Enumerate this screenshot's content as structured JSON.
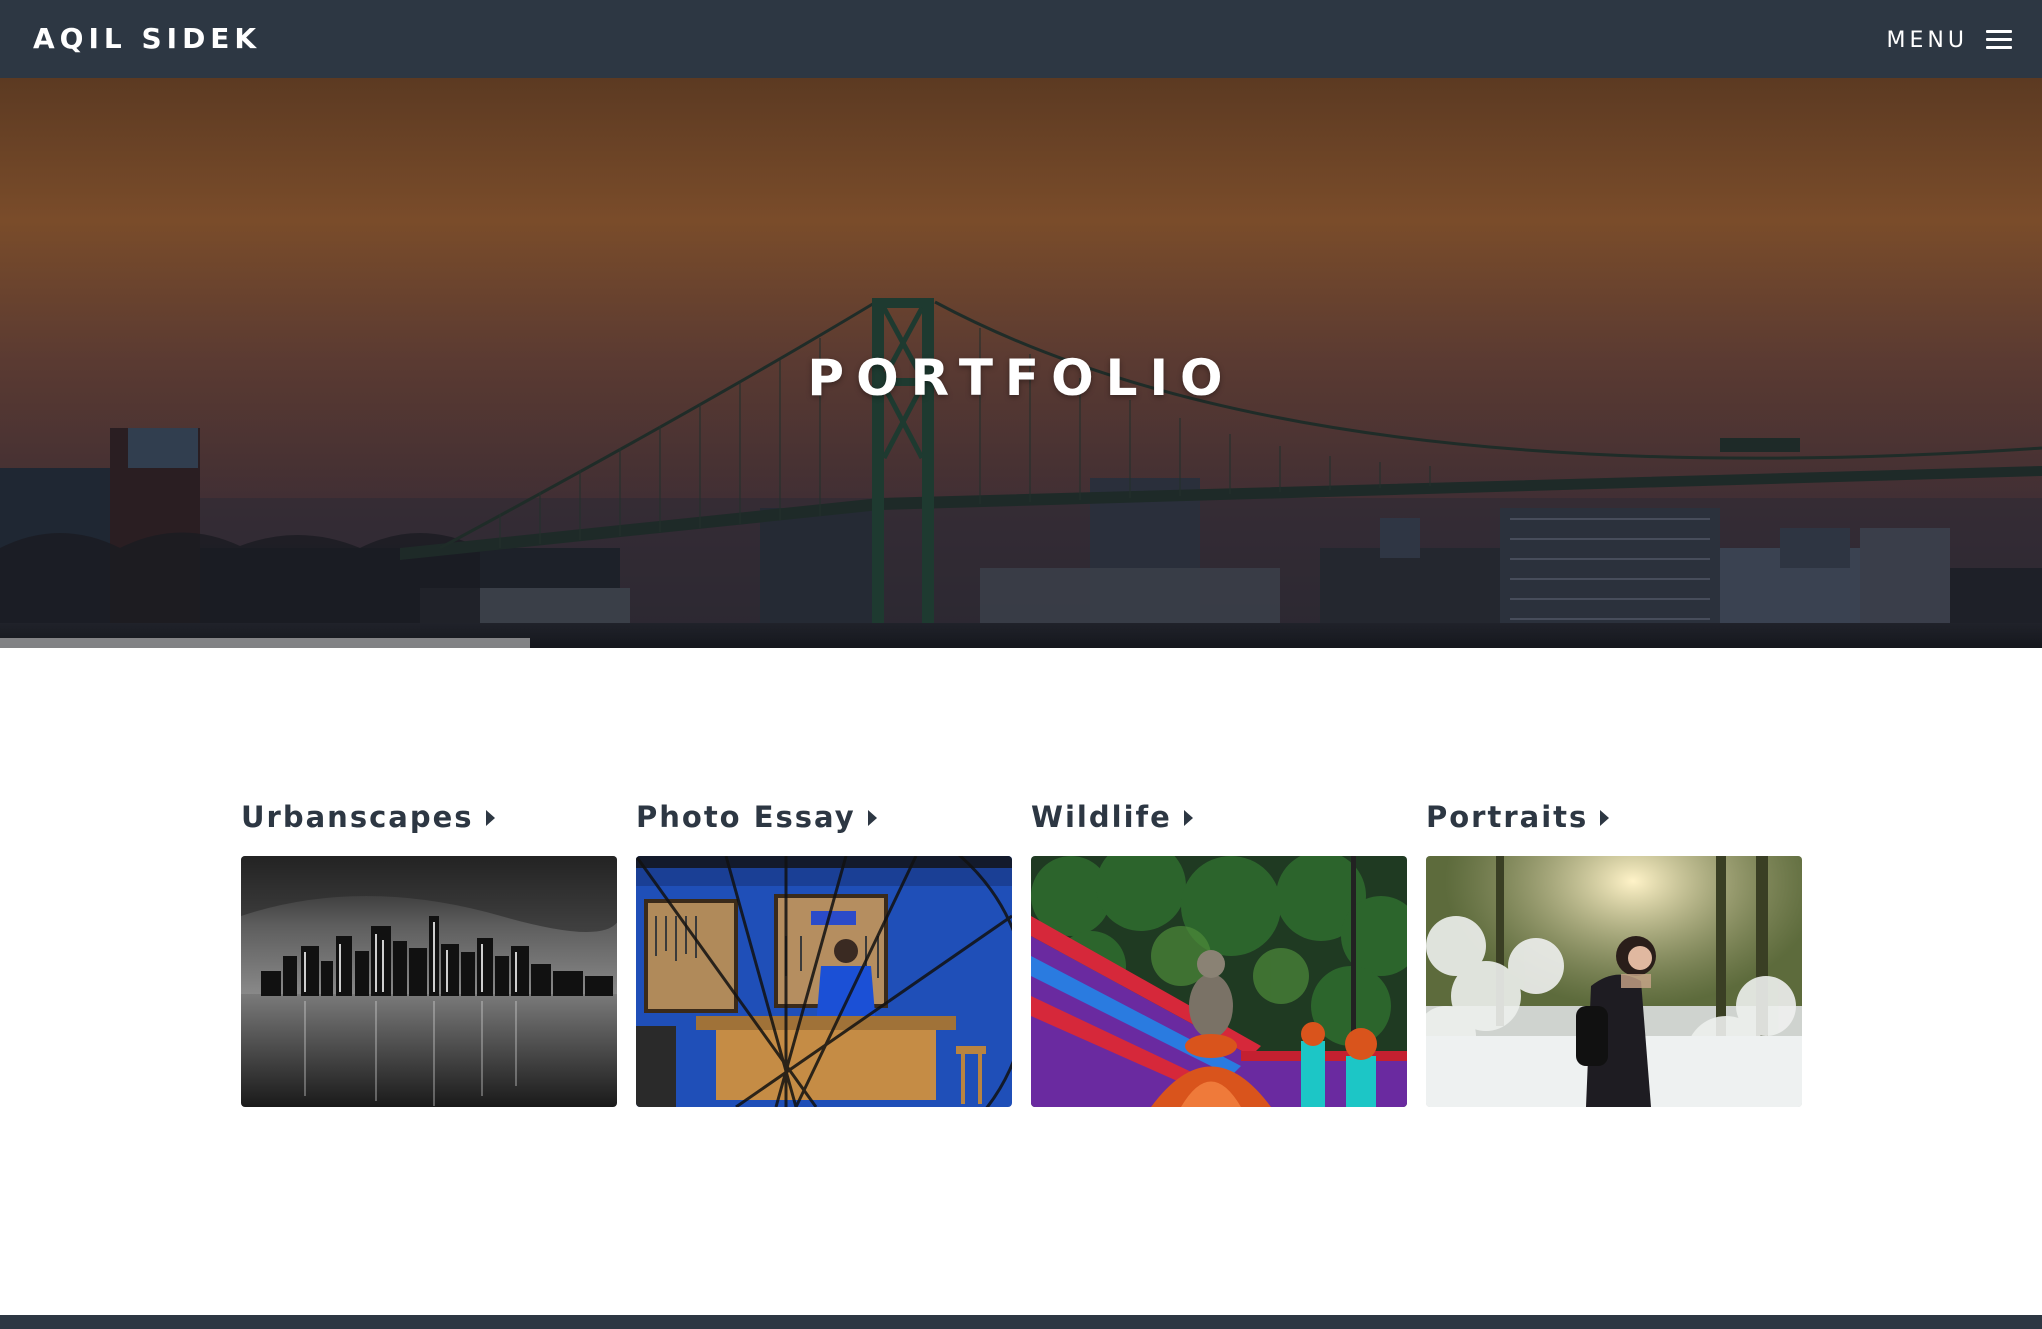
{
  "navbar": {
    "brand": "AQIL SIDEK",
    "menu_label": "MENU",
    "menu_icon": "hamburger-icon"
  },
  "hero": {
    "title": "PORTFOLIO",
    "image": "bridge-sunset-skyline"
  },
  "portfolio": {
    "items": [
      {
        "label": "Urbanscapes",
        "image": "night-city-skyline-bw"
      },
      {
        "label": "Photo Essay",
        "image": "bicycle-workshop"
      },
      {
        "label": "Wildlife",
        "image": "monkey-on-temple-stairs"
      },
      {
        "label": "Portraits",
        "image": "woman-in-snowy-forest"
      }
    ]
  },
  "colors": {
    "navbar_bg": "#2d3743",
    "text_dark": "#2d3743",
    "hero_sky_top": "#6e4526",
    "hero_sky_bottom": "#3a2a2e"
  }
}
